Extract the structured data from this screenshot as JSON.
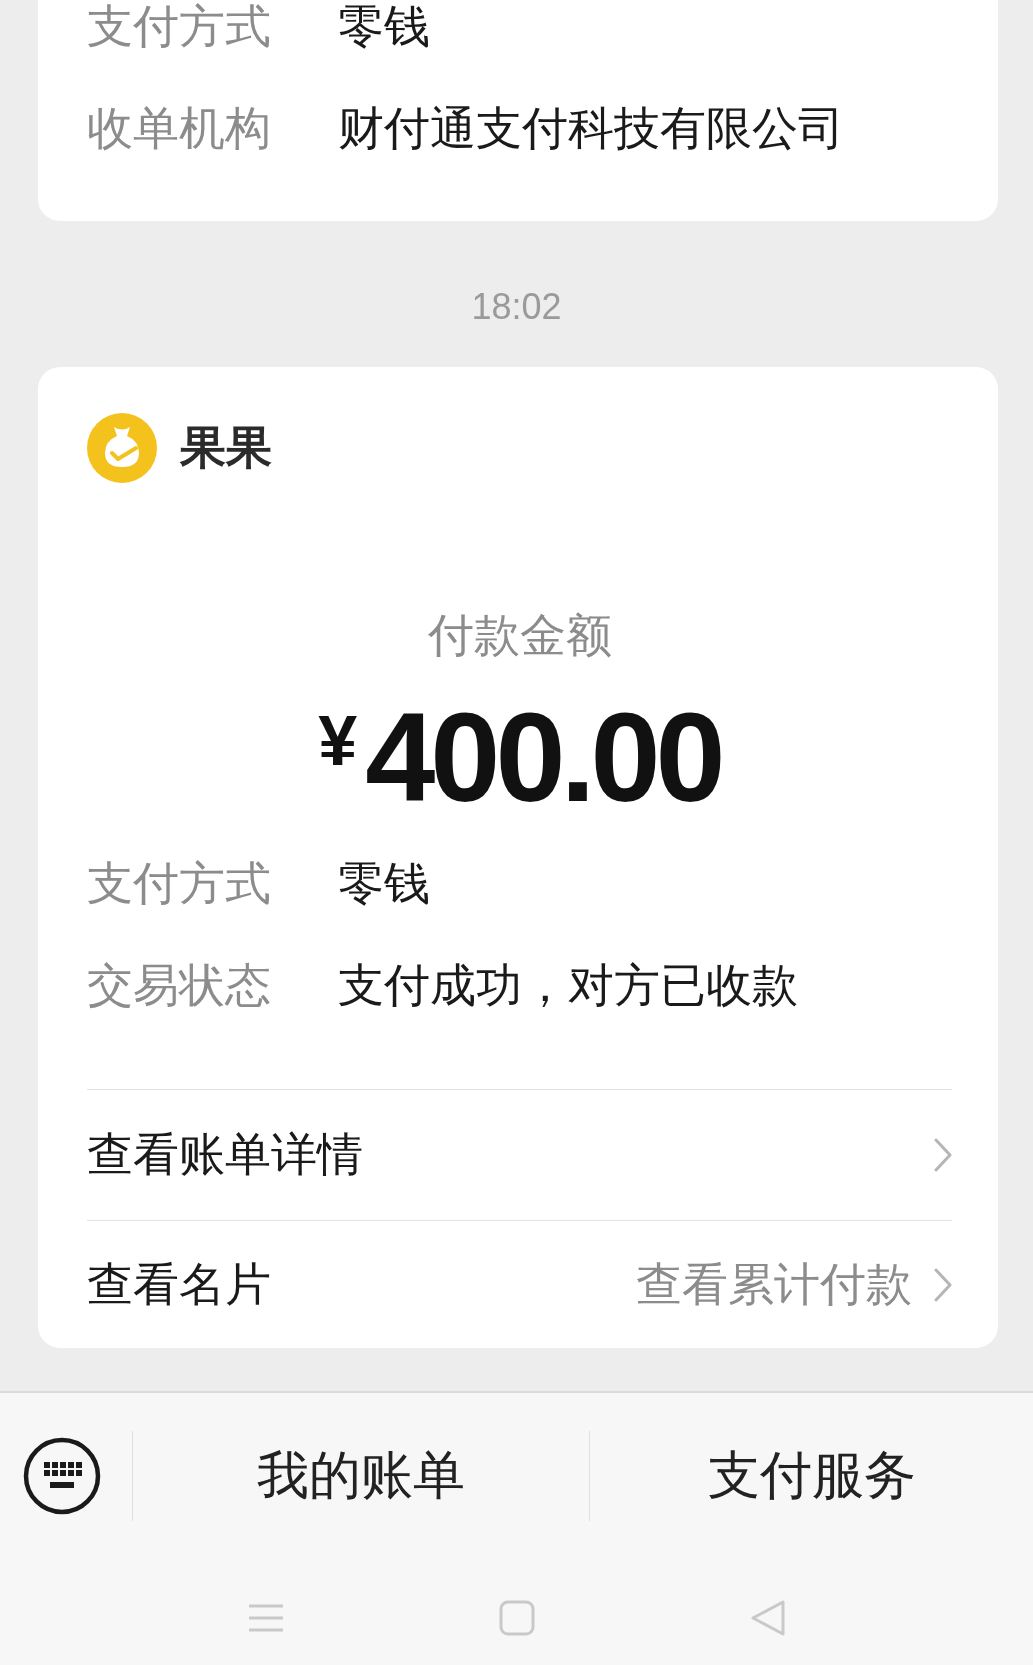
{
  "previous_card": {
    "rows": [
      {
        "label": "支付方式",
        "value": "零钱"
      },
      {
        "label": "收单机构",
        "value": "财付通支付科技有限公司"
      }
    ]
  },
  "timestamp": "18:02",
  "payment_card": {
    "payer": "果果",
    "amount_label": "付款金额",
    "currency": "¥",
    "amount": "400.00",
    "rows": [
      {
        "label": "支付方式",
        "value": "零钱"
      },
      {
        "label": "交易状态",
        "value": "支付成功，对方已收款"
      }
    ],
    "links": [
      {
        "label": "查看账单详情"
      },
      {
        "label": "查看名片",
        "extra": "查看累计付款"
      }
    ]
  },
  "bottom_menu": {
    "items": [
      "我的账单",
      "支付服务"
    ]
  }
}
